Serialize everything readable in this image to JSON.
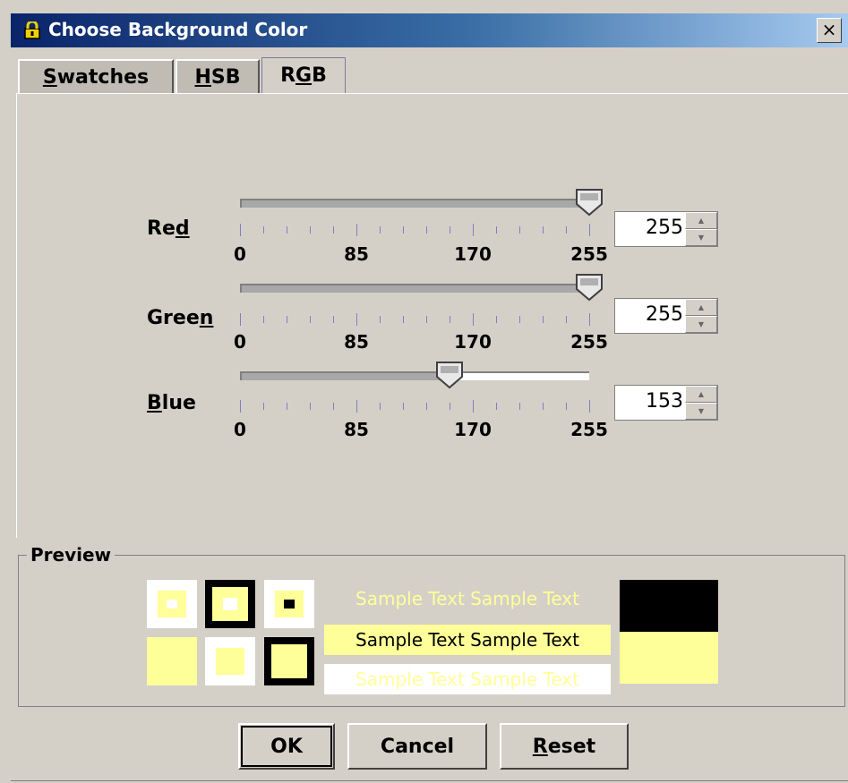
{
  "window": {
    "title": "Choose Background Color",
    "close_label": "×",
    "title_icon": "lock-icon"
  },
  "tabs": [
    {
      "label_pre": "",
      "label_u": "S",
      "label_post": "watches",
      "selected": false
    },
    {
      "label_pre": "",
      "label_u": "H",
      "label_post": "SB",
      "selected": false
    },
    {
      "label_pre": "R",
      "label_u": "G",
      "label_post": "B",
      "selected": true
    }
  ],
  "sliders": [
    {
      "name": "red",
      "label_pre": "Re",
      "label_u": "d",
      "label_post": "",
      "value": 255,
      "value_text": "255",
      "min": 0,
      "max": 255
    },
    {
      "name": "green",
      "label_pre": "Gree",
      "label_u": "n",
      "label_post": "",
      "value": 255,
      "value_text": "255",
      "min": 0,
      "max": 255
    },
    {
      "name": "blue",
      "label_pre": "",
      "label_u": "B",
      "label_post": "lue",
      "value": 153,
      "value_text": "153",
      "min": 0,
      "max": 255
    }
  ],
  "tick_labels": [
    "0",
    "85",
    "170",
    "255"
  ],
  "preview": {
    "title": "Preview",
    "sample_text": "Sample Text  Sample Text",
    "color": "#ffff99"
  },
  "buttons": {
    "ok": "OK",
    "cancel": "Cancel",
    "reset_u": "R",
    "reset_post": "eset"
  }
}
